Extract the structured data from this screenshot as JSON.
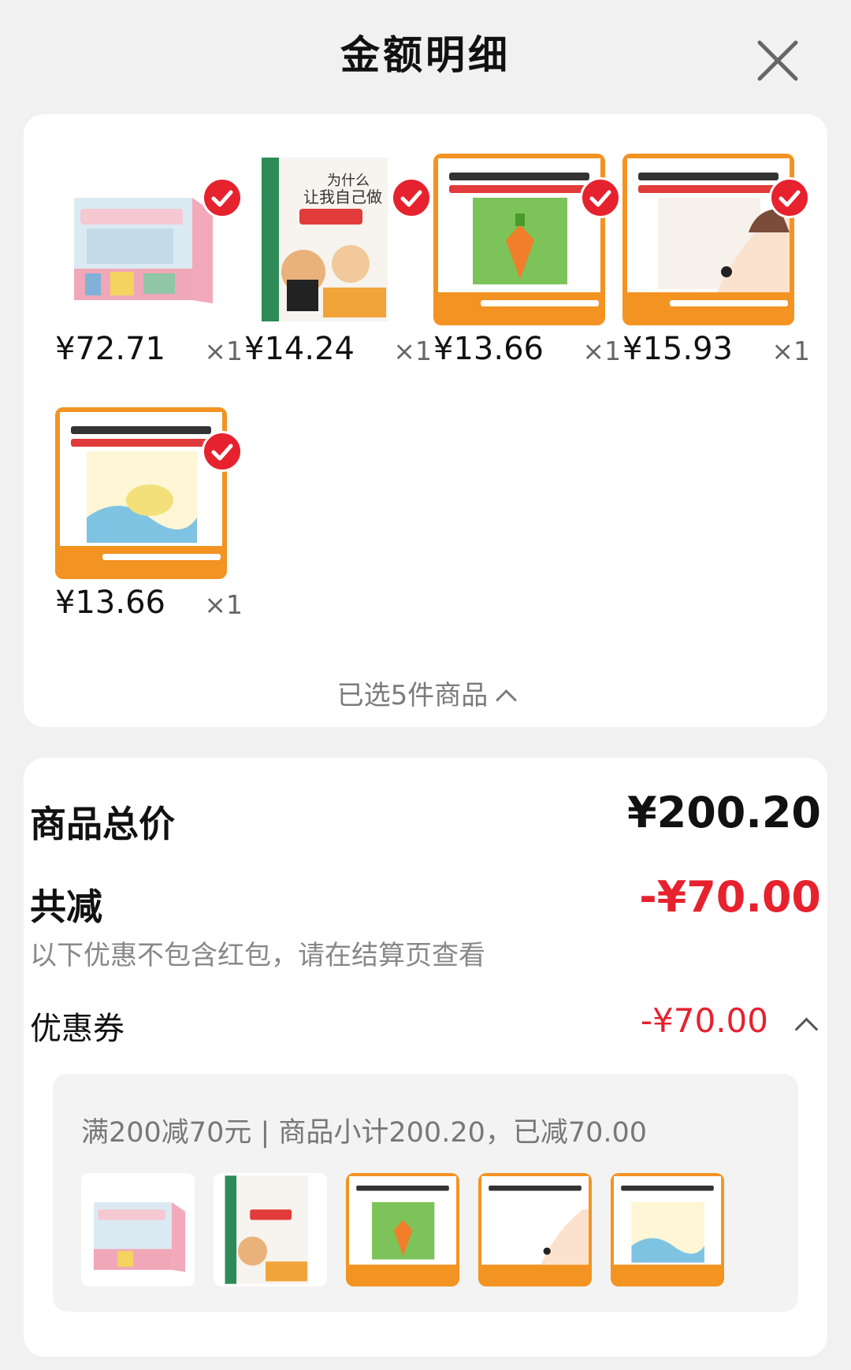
{
  "header": {
    "title": "金额明细",
    "close_icon": "close-icon"
  },
  "products": [
    {
      "price": "¥72.71",
      "qty": "×1",
      "cover": "science-encyclopedia-book-cover",
      "selected": true
    },
    {
      "price": "¥14.24",
      "qty": "×1",
      "cover": "why-let-me-do-it-myself-book-cover",
      "selected": true
    },
    {
      "price": "¥13.66",
      "qty": "×1",
      "cover": "picky-eater-carrot-book-cover",
      "selected": true
    },
    {
      "price": "¥15.93",
      "qty": "×1",
      "cover": "eye-care-book-cover",
      "selected": true
    },
    {
      "price": "¥13.66",
      "qty": "×1",
      "cover": "mr-carrot-bath-book-cover",
      "selected": true
    }
  ],
  "selected_summary": "已选5件商品",
  "totals": {
    "goods_total_label": "商品总价",
    "goods_total_value": "¥200.20",
    "reduction_label": "共减",
    "reduction_value": "-¥70.00",
    "note": "以下优惠不包含红包，请在结算页查看",
    "coupon_label": "优惠券",
    "coupon_value": "-¥70.00"
  },
  "coupon_detail": {
    "rule": "满200减70元 | 商品小计200.20，已减70.00"
  },
  "colors": {
    "accent": "#e6222f",
    "orange": "#f39322",
    "background": "#f1f1f1"
  }
}
